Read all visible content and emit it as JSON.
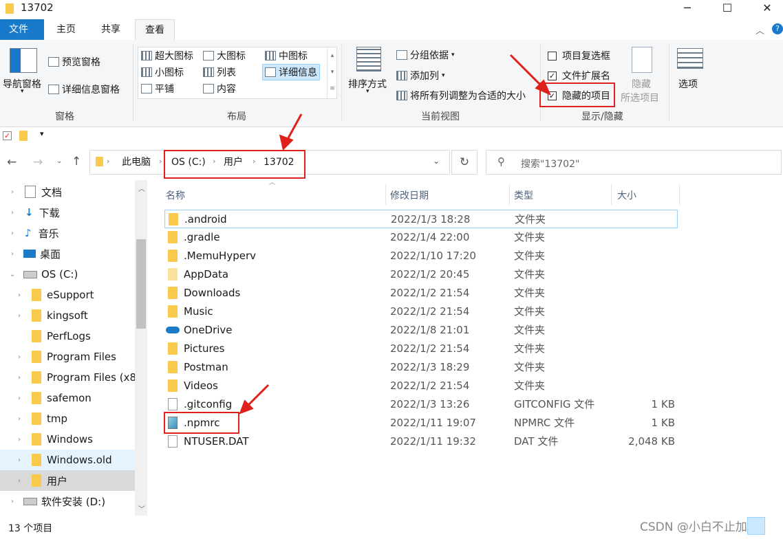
{
  "window": {
    "title": "13702",
    "minimize": "─",
    "maximize": "☐",
    "close": "✕"
  },
  "tabs": [
    {
      "label": "文件"
    },
    {
      "label": "主页"
    },
    {
      "label": "共享"
    },
    {
      "label": "查看"
    }
  ],
  "ribbon": {
    "panes": {
      "nav_pane": "导航窗格",
      "preview": "预览窗格",
      "details": "详细信息窗格",
      "group_label": "窗格"
    },
    "layout": {
      "xl_icons": "超大图标",
      "large_icons": "大图标",
      "medium_icons": "中图标",
      "small_icons": "小图标",
      "list": "列表",
      "details": "详细信息",
      "tiles": "平铺",
      "content": "内容",
      "group_label": "布局"
    },
    "current_view": {
      "sort": "排序方式",
      "group_by": "分组依据",
      "add_col": "添加列",
      "fit_cols": "将所有列调整为合适的大小",
      "group_label": "当前视图"
    },
    "show_hide": {
      "item_checkboxes": "项目复选框",
      "extensions": "文件扩展名",
      "hidden_items": "隐藏的项目",
      "hide": "隐藏",
      "hide_sub": "所选项目",
      "group_label": "显示/隐藏"
    },
    "options": "选项"
  },
  "address": {
    "crumbs": [
      "此电脑",
      "OS (C:)",
      "用户",
      "13702"
    ],
    "search_placeholder": "搜索\"13702\""
  },
  "nav": {
    "items": [
      {
        "label": "文档"
      },
      {
        "label": "下载"
      },
      {
        "label": "音乐"
      },
      {
        "label": "桌面"
      },
      {
        "label": "OS (C:)"
      },
      {
        "label": "eSupport"
      },
      {
        "label": "kingsoft"
      },
      {
        "label": "PerfLogs"
      },
      {
        "label": "Program Files"
      },
      {
        "label": "Program Files (x8"
      },
      {
        "label": "safemon"
      },
      {
        "label": "tmp"
      },
      {
        "label": "Windows"
      },
      {
        "label": "Windows.old"
      },
      {
        "label": "用户"
      },
      {
        "label": "软件安装 (D:)"
      }
    ]
  },
  "columns": {
    "name": "名称",
    "date": "修改日期",
    "type": "类型",
    "size": "大小"
  },
  "files": [
    {
      "name": ".android",
      "date": "2022/1/3 18:28",
      "type": "文件夹",
      "size": ""
    },
    {
      "name": ".gradle",
      "date": "2022/1/4 22:00",
      "type": "文件夹",
      "size": ""
    },
    {
      "name": ".MemuHyperv",
      "date": "2022/1/10 17:20",
      "type": "文件夹",
      "size": ""
    },
    {
      "name": "AppData",
      "date": "2022/1/2 20:45",
      "type": "文件夹",
      "size": ""
    },
    {
      "name": "Downloads",
      "date": "2022/1/2 21:54",
      "type": "文件夹",
      "size": ""
    },
    {
      "name": "Music",
      "date": "2022/1/2 21:54",
      "type": "文件夹",
      "size": ""
    },
    {
      "name": "OneDrive",
      "date": "2022/1/8 21:01",
      "type": "文件夹",
      "size": ""
    },
    {
      "name": "Pictures",
      "date": "2022/1/2 21:54",
      "type": "文件夹",
      "size": ""
    },
    {
      "name": "Postman",
      "date": "2022/1/3 18:29",
      "type": "文件夹",
      "size": ""
    },
    {
      "name": "Videos",
      "date": "2022/1/2 21:54",
      "type": "文件夹",
      "size": ""
    },
    {
      "name": ".gitconfig",
      "date": "2022/1/3 13:26",
      "type": "GITCONFIG 文件",
      "size": "1 KB"
    },
    {
      "name": ".npmrc",
      "date": "2022/1/11 19:07",
      "type": "NPMRC 文件",
      "size": "1 KB"
    },
    {
      "name": "NTUSER.DAT",
      "date": "2022/1/11 19:32",
      "type": "DAT 文件",
      "size": "2,048 KB"
    }
  ],
  "status": {
    "count": "13 个项目"
  },
  "watermark": "CSDN @小白不止加油",
  "colors": {
    "file_tab": "#1979ca",
    "annotation": "#e0201b",
    "folder": "#f8c94a"
  }
}
